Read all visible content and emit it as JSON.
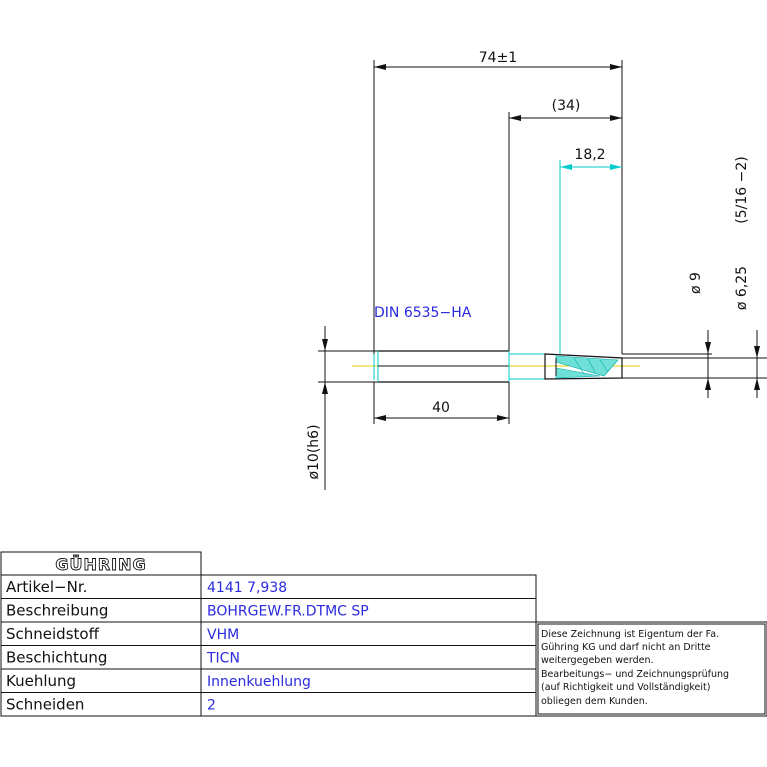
{
  "drawing": {
    "dim_overall": "74±1",
    "dim_thread": "(34)",
    "dim_cut": "18,2",
    "dim_shank_len": "40",
    "dim_thread_size": "(5/16 −2)",
    "dim_dia_cut": "ø 6,25",
    "dim_dia_9": "ø 9",
    "dim_dia_shank": "ø10(h6)",
    "standard_label": "DIN 6535−HA"
  },
  "titleblock": {
    "logo": "GÜHRING",
    "rows": [
      {
        "label": "Artikel−Nr.",
        "value": "4141  7,938"
      },
      {
        "label": "Beschreibung",
        "value": "BOHRGEW.FR.DTMC  SP"
      },
      {
        "label": "Schneidstoff",
        "value": "VHM"
      },
      {
        "label": "Beschichtung",
        "value": "TICN"
      },
      {
        "label": "Kuehlung",
        "value": "Innenkuehlung"
      },
      {
        "label": "Schneiden",
        "value": "2"
      }
    ],
    "notice_lines": [
      "Diese Zeichnung ist Eigentum der Fa.",
      "Gühring KG und darf nicht an Dritte",
      "weitergegeben werden.",
      "Bearbeitungs− und Zeichnungsprüfung",
      "(auf Richtigkeit und Vollständigkeit)",
      "obliegen dem Kunden."
    ]
  },
  "colors": {
    "line": "#111111",
    "cyan": "#00cccc",
    "blue_text": "#2a2ae0",
    "axis": "#e6d200"
  }
}
